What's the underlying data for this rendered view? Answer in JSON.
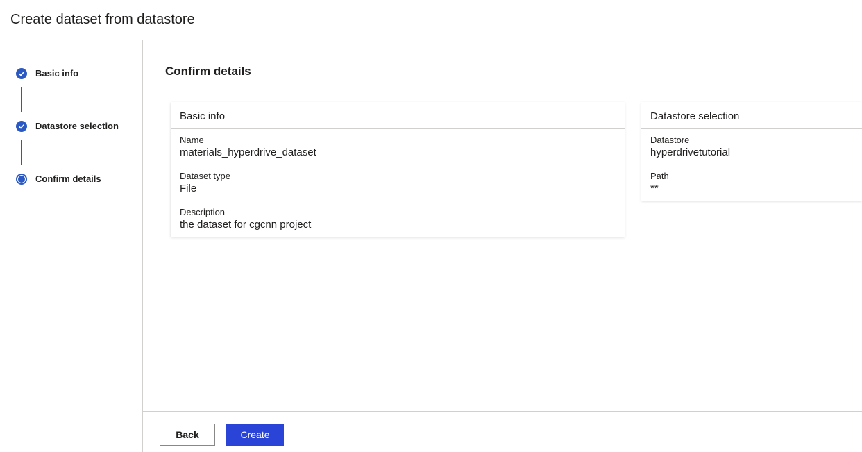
{
  "header": {
    "title": "Create dataset from datastore"
  },
  "steps": [
    {
      "label": "Basic info",
      "state": "completed"
    },
    {
      "label": "Datastore selection",
      "state": "completed"
    },
    {
      "label": "Confirm details",
      "state": "current"
    }
  ],
  "main": {
    "title": "Confirm details",
    "basic_info_card": {
      "title": "Basic info",
      "fields": [
        {
          "label": "Name",
          "value": "materials_hyperdrive_dataset"
        },
        {
          "label": "Dataset type",
          "value": "File"
        },
        {
          "label": "Description",
          "value": "the dataset for cgcnn project"
        }
      ]
    },
    "datastore_card": {
      "title": "Datastore selection",
      "fields": [
        {
          "label": "Datastore",
          "value": "hyperdrivetutorial"
        },
        {
          "label": "Path",
          "value": "**"
        }
      ]
    }
  },
  "footer": {
    "back_label": "Back",
    "create_label": "Create"
  },
  "colors": {
    "accent": "#2b59c3",
    "primary_button": "#2b44d8",
    "border": "#d2d0ce"
  }
}
